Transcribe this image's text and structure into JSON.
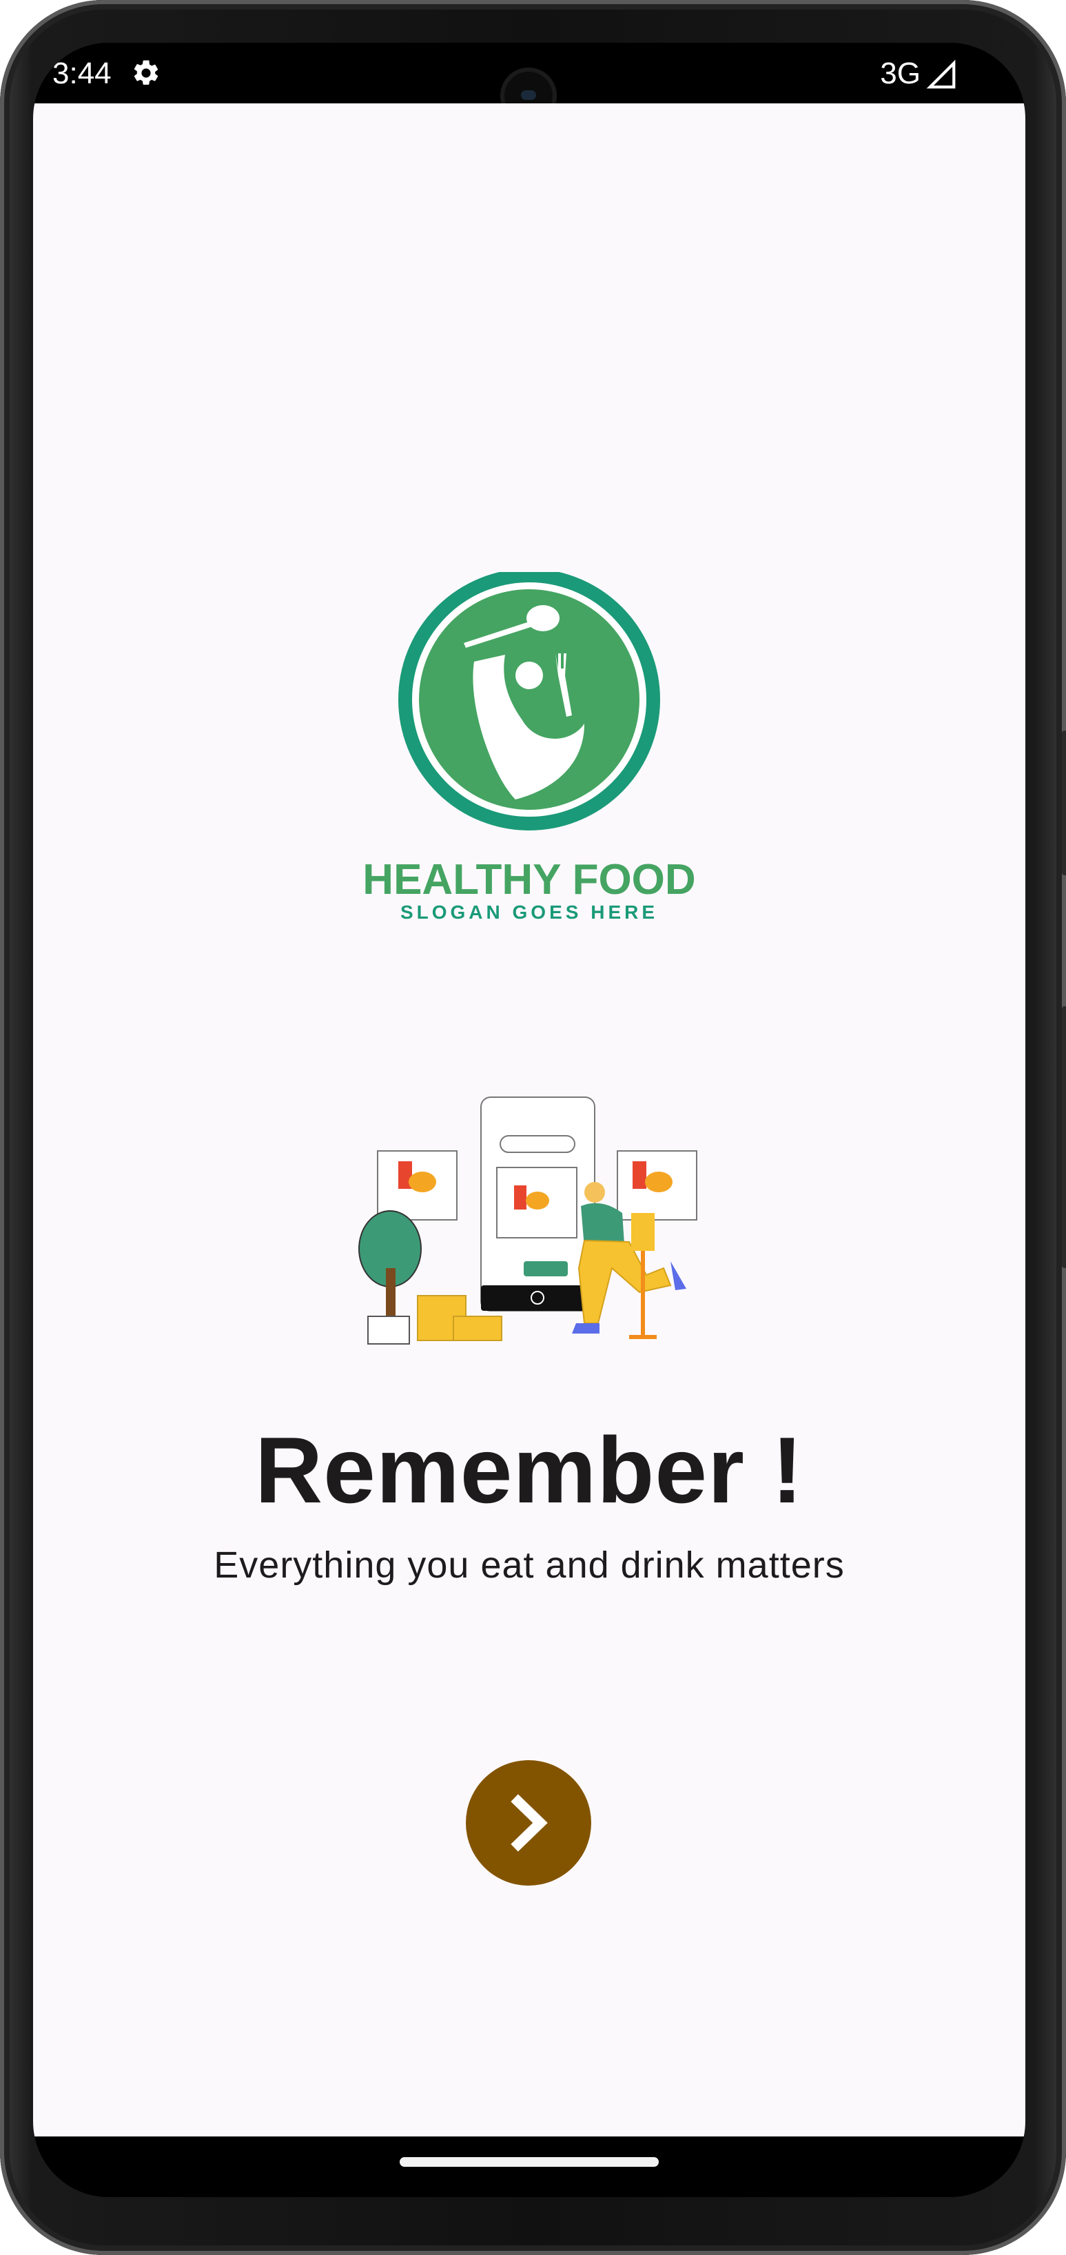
{
  "status_bar": {
    "time": "3:44",
    "network": "3G",
    "icons": [
      "gear-icon",
      "signal-icon"
    ]
  },
  "logo": {
    "brand_name": "HEALTHY FOOD",
    "slogan": "SLOGAN GOES HERE",
    "colors": {
      "ring": "#1a9a78",
      "fill": "#45a462",
      "text": "#45a462",
      "slogan": "#1a9a78"
    }
  },
  "illustration": {
    "icon": "food-ordering-illustration"
  },
  "onboarding": {
    "title": "Remember !",
    "subtitle": "Everything you eat and drink matters"
  },
  "next_button": {
    "icon": "chevron-right-icon",
    "color": "#835400"
  }
}
